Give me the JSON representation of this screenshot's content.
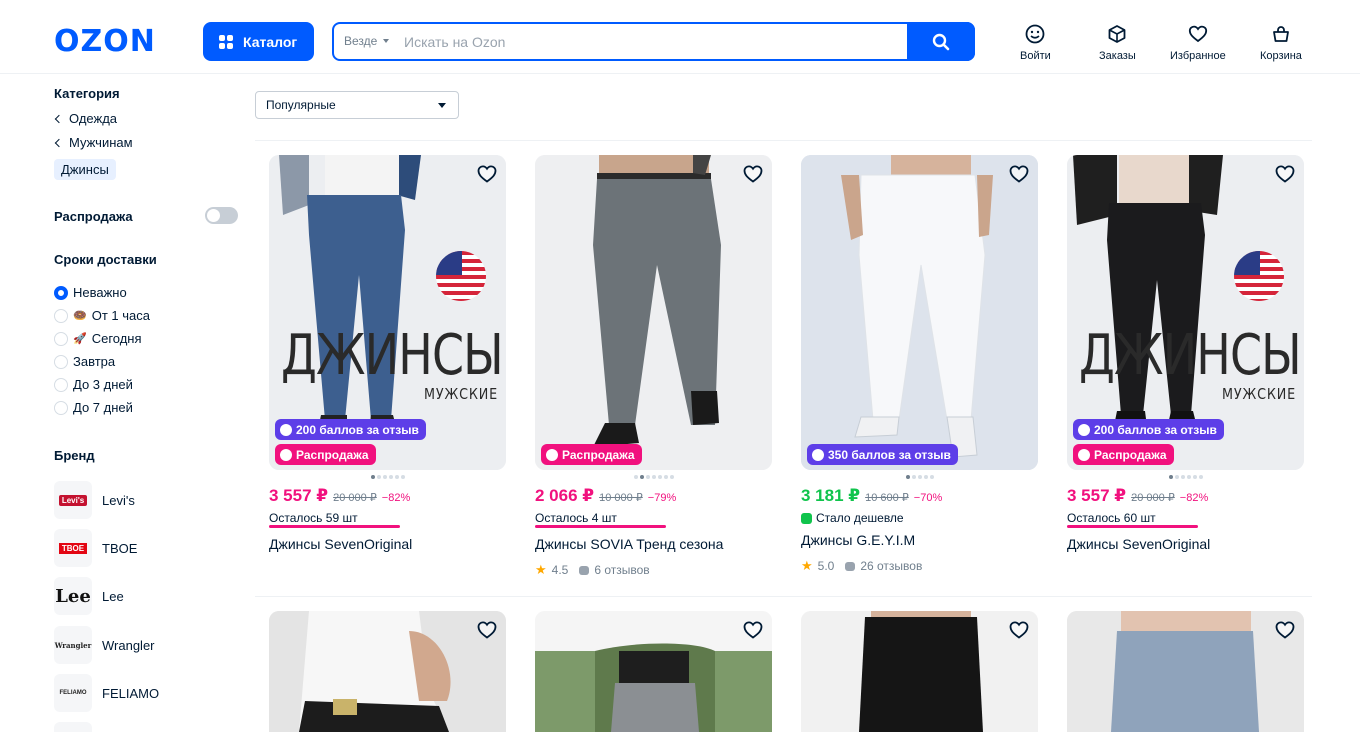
{
  "header": {
    "logo": "OZON",
    "catalog_label": "Каталог",
    "search_scope": "Везде",
    "search_placeholder": "Искать на Ozon",
    "actions": {
      "login": "Войти",
      "orders": "Заказы",
      "favorites": "Избранное",
      "cart": "Корзина"
    }
  },
  "sidebar": {
    "category_title": "Категория",
    "categories": [
      "Одежда",
      "Мужчинам"
    ],
    "active_category": "Джинсы",
    "sale_title": "Распродажа",
    "sale_enabled": false,
    "delivery_title": "Сроки доставки",
    "delivery_options": [
      {
        "label": "Неважно",
        "selected": true,
        "emoji": ""
      },
      {
        "label": "От 1 часа",
        "selected": false,
        "emoji": "🍩"
      },
      {
        "label": "Сегодня",
        "selected": false,
        "emoji": "🚀"
      },
      {
        "label": "Завтра",
        "selected": false,
        "emoji": ""
      },
      {
        "label": "До 3 дней",
        "selected": false,
        "emoji": ""
      },
      {
        "label": "До 7 дней",
        "selected": false,
        "emoji": ""
      }
    ],
    "brand_title": "Бренд",
    "brands": [
      {
        "name": "Levi's",
        "logo_text": "Levi's",
        "logo_color": "#c41230"
      },
      {
        "name": "TBOE",
        "logo_text": "TBOE",
        "logo_color": "#e30613"
      },
      {
        "name": "Lee",
        "logo_text": "Lee",
        "logo_color": "#111111"
      },
      {
        "name": "Wrangler",
        "logo_text": "Wrangler",
        "logo_color": "#222222"
      },
      {
        "name": "FELIAMO",
        "logo_text": "FELIAMO",
        "logo_color": "#222222"
      }
    ]
  },
  "sort": {
    "selected": "Популярные"
  },
  "products": [
    {
      "price": "3 557 ₽",
      "old_price": "20 000 ₽",
      "discount": "−82%",
      "price_color": "pink",
      "badges": [
        {
          "type": "points",
          "text": "200 баллов за отзыв"
        },
        {
          "type": "sale",
          "text": "Распродажа"
        }
      ],
      "stock": "Осталось 59 шт",
      "title": "Джинсы SevenOriginal",
      "image_text": "ДЖИНСЫ",
      "image_subtext": "МУЖСКИЕ",
      "jeans_color": "#3d5f8f",
      "bg_color": "#eceef1"
    },
    {
      "price": "2 066 ₽",
      "old_price": "10 000 ₽",
      "discount": "−79%",
      "price_color": "pink",
      "badges": [
        {
          "type": "sale",
          "text": "Распродажа"
        }
      ],
      "stock": "Осталось 4 шт",
      "title": "Джинсы SOVIA Тренд сезона",
      "rating": "4.5",
      "reviews": "6 отзывов",
      "jeans_color": "#6c7378",
      "bg_color": "#eeeff1"
    },
    {
      "price": "3 181 ₽",
      "old_price": "10 600 ₽",
      "discount": "−70%",
      "price_color": "green",
      "badges": [
        {
          "type": "points",
          "text": "350 баллов за отзыв"
        }
      ],
      "note": "Стало дешевле",
      "title": "Джинсы G.E.Y.I.M",
      "rating": "5.0",
      "reviews": "26 отзывов",
      "jeans_color": "#f7f8fa",
      "bg_color": "#d9e0ea"
    },
    {
      "price": "3 557 ₽",
      "old_price": "20 000 ₽",
      "discount": "−82%",
      "price_color": "pink",
      "badges": [
        {
          "type": "points",
          "text": "200 баллов за отзыв"
        },
        {
          "type": "sale",
          "text": "Распродажа"
        }
      ],
      "stock": "Осталось 60 шт",
      "title": "Джинсы SevenOriginal",
      "image_text": "ДЖИНСЫ",
      "image_subtext": "МУЖСКИЕ",
      "jeans_color": "#1b1b1d",
      "bg_color": "#eceef1"
    }
  ],
  "products_row2": [
    {
      "jeans_color": "#1c1c1c",
      "bg_color": "#e9e9e9"
    },
    {
      "jeans_color": "#8b8f93",
      "bg_color": "#7d9a6a"
    },
    {
      "jeans_color": "#151515",
      "bg_color": "#f1f1f1"
    },
    {
      "jeans_color": "#8fa3bb",
      "bg_color": "#e6e6e6"
    }
  ]
}
